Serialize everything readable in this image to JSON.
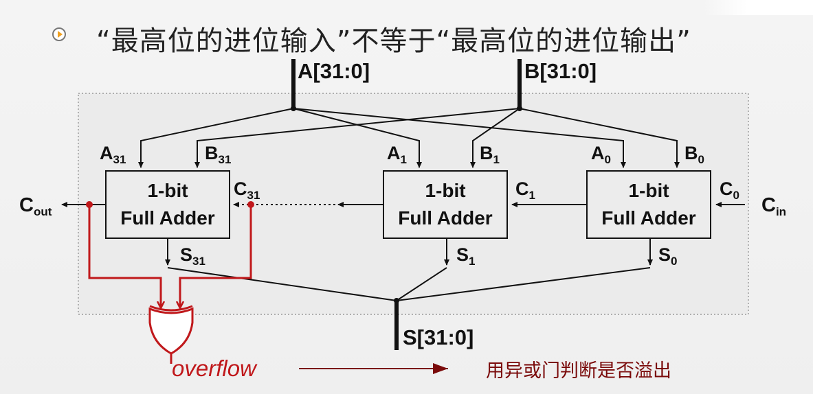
{
  "slide": {
    "title": "“最高位的进位输入”不等于“最高位的进位输出”"
  },
  "buses": {
    "a_in": "A[31:0]",
    "b_in": "B[31:0]",
    "s_out": "S[31:0]"
  },
  "adders": [
    {
      "line1": "1-bit",
      "line2": "Full Adder"
    },
    {
      "line1": "1-bit",
      "line2": "Full Adder"
    },
    {
      "line1": "1-bit",
      "line2": "Full Adder"
    }
  ],
  "ports": {
    "a31": {
      "base": "A",
      "sub": "31"
    },
    "b31": {
      "base": "B",
      "sub": "31"
    },
    "a1": {
      "base": "A",
      "sub": "1"
    },
    "b1": {
      "base": "B",
      "sub": "1"
    },
    "a0": {
      "base": "A",
      "sub": "0"
    },
    "b0": {
      "base": "B",
      "sub": "0"
    },
    "c31": {
      "base": "C",
      "sub": "31"
    },
    "c1": {
      "base": "C",
      "sub": "1"
    },
    "c0": {
      "base": "C",
      "sub": "0"
    },
    "cin": {
      "base": "C",
      "sub": "in"
    },
    "cout": {
      "base": "C",
      "sub": "out"
    },
    "s31": {
      "base": "S",
      "sub": "31"
    },
    "s1": {
      "base": "S",
      "sub": "1"
    },
    "s0": {
      "base": "S",
      "sub": "0"
    }
  },
  "overflow_label": "overflow",
  "note": "用异或门判断是否溢出",
  "colors": {
    "wire": "#111111",
    "highlight": "#c0181b",
    "note_arrow": "#7a0a0a"
  }
}
